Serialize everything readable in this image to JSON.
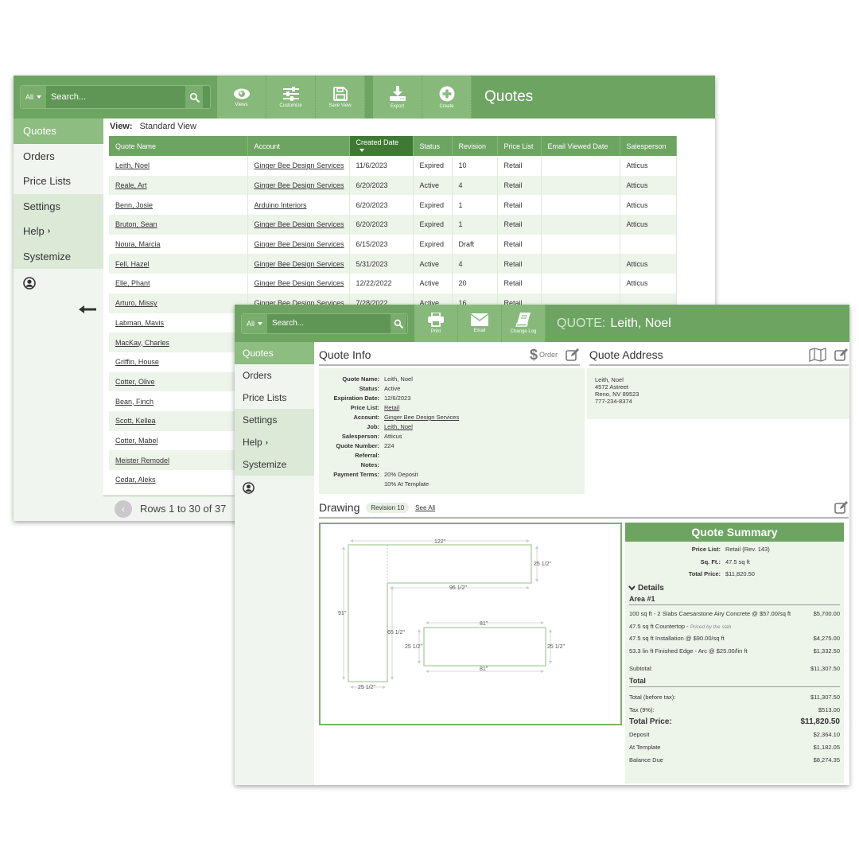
{
  "colors": {
    "brand_green": "#6ea462",
    "tool_green": "#86b97a",
    "active_nav": "#8dbd80",
    "sorted_header": "#3f7a35",
    "panel_bg": "#edf4ea"
  },
  "list_window": {
    "search": {
      "scope": "All",
      "placeholder": "Search..."
    },
    "toolbar": [
      {
        "icon": "eye-icon",
        "label": "Views"
      },
      {
        "icon": "sliders-icon",
        "label": "Customize"
      },
      {
        "icon": "floppy-disk-icon",
        "label": "Save View"
      },
      {
        "icon": "download-icon",
        "label": "Export"
      },
      {
        "icon": "plus-circle-icon",
        "label": "Create"
      }
    ],
    "title": "Quotes",
    "nav": [
      {
        "label": "Quotes",
        "state": "active"
      },
      {
        "label": "Orders"
      },
      {
        "label": "Price Lists"
      },
      {
        "label": "Settings"
      },
      {
        "label": "Help",
        "chevron": "›"
      },
      {
        "label": "Systemize"
      }
    ],
    "user_icon": "user-circle-icon",
    "collapse_icon": "arrow-left-icon",
    "view": {
      "label": "View:",
      "value": "Standard View"
    },
    "table": {
      "columns": [
        "Quote Name",
        "Account",
        "Created Date",
        "Status",
        "Revision",
        "Price List",
        "Email Viewed Date",
        "Salesperson"
      ],
      "sorted_column": "Created Date",
      "sort_direction": "descending",
      "rows": [
        [
          "Leith, Noel",
          "Ginger Bee Design Services",
          "11/6/2023",
          "Expired",
          "10",
          "Retail",
          "",
          "Atticus"
        ],
        [
          "Reale, Art",
          "Ginger Bee Design Services",
          "6/20/2023",
          "Active",
          "4",
          "Retail",
          "",
          "Atticus"
        ],
        [
          "Benn, Josie",
          "Arduino Interiors",
          "6/20/2023",
          "Expired",
          "1",
          "Retail",
          "",
          "Atticus"
        ],
        [
          "Bruton, Sean",
          "Ginger Bee Design Services",
          "6/20/2023",
          "Expired",
          "1",
          "Retail",
          "",
          "Atticus"
        ],
        [
          "Noura, Marcia",
          "Ginger Bee Design Services",
          "6/15/2023",
          "Expired",
          "Draft",
          "Retail",
          "",
          ""
        ],
        [
          "Fell, Hazel",
          "Ginger Bee Design Services",
          "5/31/2023",
          "Active",
          "4",
          "Retail",
          "",
          "Atticus"
        ],
        [
          "Elle, Phant",
          "Ginger Bee Design Services",
          "12/22/2022",
          "Active",
          "20",
          "Retail",
          "",
          "Atticus"
        ],
        [
          "Arturo, Missy",
          "Ginger Bee Design Services",
          "7/28/2022",
          "Active",
          "16",
          "Retail",
          "",
          ""
        ],
        [
          "Labman, Mavis",
          "",
          "",
          "",
          "",
          "",
          "",
          ""
        ],
        [
          "MacKay, Charles",
          "",
          "",
          "",
          "",
          "",
          "",
          ""
        ],
        [
          "Griffin, House",
          "",
          "",
          "",
          "",
          "",
          "",
          ""
        ],
        [
          "Cotter, Olive",
          "",
          "",
          "",
          "",
          "",
          "",
          ""
        ],
        [
          "Bean, Finch",
          "",
          "",
          "",
          "",
          "",
          "",
          ""
        ],
        [
          "Scott, Kellea",
          "",
          "",
          "",
          "",
          "",
          "",
          ""
        ],
        [
          "Cotter, Mabel",
          "",
          "",
          "",
          "",
          "",
          "",
          ""
        ],
        [
          "Meister Remodel",
          "",
          "",
          "",
          "",
          "",
          "",
          ""
        ],
        [
          "Cedar, Aleks",
          "",
          "",
          "",
          "",
          "",
          "",
          ""
        ]
      ]
    },
    "pager": {
      "text": "Rows 1 to 30 of 37"
    }
  },
  "detail_window": {
    "search": {
      "scope": "All",
      "placeholder": "Search..."
    },
    "toolbar": [
      {
        "icon": "printer-icon",
        "label": "Print"
      },
      {
        "icon": "envelope-icon",
        "label": "Email"
      },
      {
        "icon": "book-icon",
        "label": "Change Log"
      }
    ],
    "title_prefix": "QUOTE:",
    "title": "Leith, Noel",
    "nav": [
      {
        "label": "Quotes",
        "state": "active"
      },
      {
        "label": "Orders"
      },
      {
        "label": "Price Lists"
      },
      {
        "label": "Settings"
      },
      {
        "label": "Help",
        "chevron": "›"
      },
      {
        "label": "Systemize"
      }
    ],
    "quote_info": {
      "heading": "Quote Info",
      "order_label": "Order",
      "fields": [
        {
          "key": "Quote Name:",
          "value": "Leith, Noel"
        },
        {
          "key": "Status:",
          "value": "Active"
        },
        {
          "key": "Expiration Date:",
          "value": "12/6/2023"
        },
        {
          "key": "Price List:",
          "value": "Retail",
          "link": true
        },
        {
          "key": "Account:",
          "value": "Ginger Bee Design Services",
          "link": true
        },
        {
          "key": "Job:",
          "value": "Leith, Noel",
          "link": true
        },
        {
          "key": "Salesperson:",
          "value": "Atticus"
        },
        {
          "key": "Quote Number:",
          "value": "224"
        },
        {
          "key": "Referral:",
          "value": ""
        },
        {
          "key": "Notes:",
          "value": ""
        },
        {
          "key": "Payment Terms:",
          "value": "20% Deposit\n10% At Template"
        }
      ]
    },
    "quote_address": {
      "heading": "Quote Address",
      "lines": [
        "Leith, Noel",
        "4572 Astreet",
        "Reno, NV 89523",
        "777-234-8374"
      ]
    },
    "drawing": {
      "heading": "Drawing",
      "revision_badge": "Revision 10",
      "see_all": "See All",
      "dimensions": {
        "l_top_width": "122\"",
        "l_top_depth": "25 1/2\"",
        "l_inner_width": "96 1/2\"",
        "l_total_height": "91\"",
        "l_inner_height": "65 1/2\"",
        "l_leg_width": "25 1/2\"",
        "island_top": "81\"",
        "island_bottom": "81\"",
        "island_left": "25 1/2\"",
        "island_right": "25 1/2\""
      }
    },
    "summary": {
      "heading": "Quote Summary",
      "top": [
        {
          "key": "Price List:",
          "value": "Retail (Rev. 143)"
        },
        {
          "key": "Sq. Ft.:",
          "value": "47.5 sq ft"
        },
        {
          "key": "Total Price:",
          "value": "$11,820.50"
        }
      ],
      "details_label": "Details",
      "area_title": "Area #1",
      "items": [
        {
          "desc": "100 sq ft - 2 Slabs Caesarstone Airy Concrete @ $57.00/sq ft",
          "note": "",
          "amount": "$5,700.00"
        },
        {
          "desc": "47.5 sq ft Countertop - ",
          "note": "Priced by the slab",
          "amount": ""
        },
        {
          "desc": "47.5 sq ft Installation @ $90.00/sq ft",
          "note": "",
          "amount": "$4,275.00"
        },
        {
          "desc": "53.3 lin ft Finished Edge - Arc @ $25.00/lin ft",
          "note": "",
          "amount": "$1,332.50"
        }
      ],
      "subtotal": {
        "label": "Subtotal:",
        "amount": "$11,307.50"
      },
      "total_title": "Total",
      "totals": [
        {
          "label": "Total (before tax):",
          "amount": "$11,307.50"
        },
        {
          "label": "Tax (9%):",
          "amount": "$513.00"
        }
      ],
      "total_price": {
        "label": "Total Price:",
        "amount": "$11,820.50"
      },
      "payments": [
        {
          "label": "Deposit",
          "amount": "$2,364.10"
        },
        {
          "label": "At Template",
          "amount": "$1,182.05"
        },
        {
          "label": "Balance Due",
          "amount": "$8,274.35"
        }
      ]
    }
  }
}
